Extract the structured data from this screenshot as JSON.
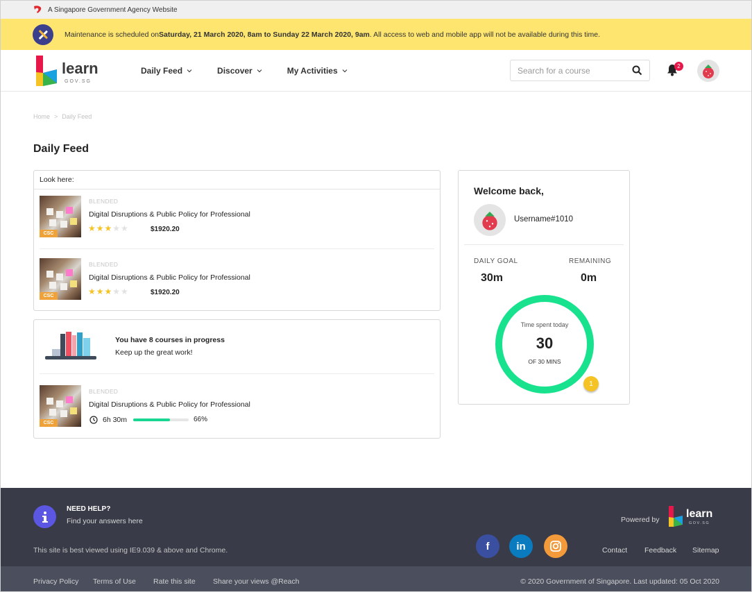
{
  "gov_bar": {
    "text": "A Singapore Government Agency Website"
  },
  "maintenance": {
    "prefix": "Maintenance is scheduled on ",
    "period": "Saturday, 21 March 2020, 8am to Sunday 22 March 2020, 9am",
    "suffix": ".  All access to web and mobile app will not be available during this time."
  },
  "header": {
    "logo_text": "learn",
    "logo_sub": "GOV.SG",
    "nav": [
      "Daily Feed",
      "Discover",
      "My Activities"
    ],
    "search_placeholder": "Search for a course",
    "notification_count": "2"
  },
  "breadcrumb": [
    "Home",
    "Daily Feed"
  ],
  "page_title": "Daily Feed",
  "look_here": {
    "header": "Look here:",
    "courses": [
      {
        "type": "BLENDED",
        "title": "Digital Disruptions & Public Policy for Professional",
        "rating": 3,
        "rating_max": 5,
        "price": "$1920.20",
        "tag": "CSC"
      },
      {
        "type": "BLENDED",
        "title": "Digital Disruptions & Public Policy for Professional",
        "rating": 3,
        "rating_max": 5,
        "price": "$1920.20",
        "tag": "CSC"
      }
    ]
  },
  "progress": {
    "title": "You have 8 courses in progress",
    "subtitle": "Keep up the great work!",
    "course": {
      "type": "BLENDED",
      "title": "Digital Disruptions & Public Policy for Professional",
      "duration": "6h 30m",
      "percent_label": "66%",
      "percent": 66,
      "tag": "CSC"
    }
  },
  "welcome": {
    "title": "Welcome back,",
    "username": "Username#1010",
    "daily_goal_label": "DAILY GOAL",
    "daily_goal_value": "30m",
    "remaining_label": "REMAINING",
    "remaining_value": "0m",
    "ring_label": "Time spent today",
    "ring_value": "30",
    "ring_sub": "OF 30 MINS",
    "coin": "1",
    "ring_color": "#19e28e"
  },
  "footer": {
    "help_title": "NEED HELP?",
    "help_sub": "Find your answers here",
    "best_viewed": "This site is best viewed using IE9.039 & above and Chrome.",
    "powered_by": "Powered by",
    "logo_text": "learn",
    "logo_sub": "GOV.SG",
    "social": {
      "facebook": "f",
      "linkedin": "in"
    },
    "links": [
      "Contact",
      "Feedback",
      "Sitemap"
    ],
    "bottom_links": [
      "Privacy Policy",
      "Terms of Use",
      "Rate this site",
      "Share your views @Reach"
    ],
    "copyright": "© 2020 Government of Singapore. Last updated: 05 Oct 2020"
  }
}
